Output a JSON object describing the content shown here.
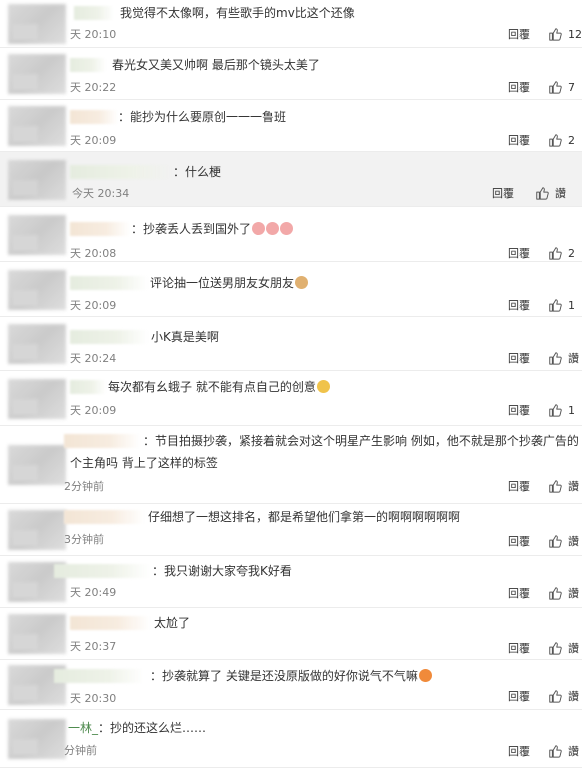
{
  "comments": [
    {
      "text": "我觉得不太像啊，有些歌手的mv比这个还像",
      "time": "天 20:10",
      "reply": "回覆",
      "likes": "12",
      "emoji": ""
    },
    {
      "text": "春光女又美又帅啊 最后那个镜头太美了",
      "time": "天 20:22",
      "reply": "回覆",
      "likes": "7",
      "emoji": ""
    },
    {
      "text": "：能抄为什么要原创一一一鲁班",
      "time": "天 20:09",
      "reply": "回覆",
      "likes": "2",
      "emoji": ""
    },
    {
      "text": "：什么梗",
      "time": "今天 20:34",
      "reply": "回覆",
      "likes": "讚",
      "emoji": ""
    },
    {
      "text": "：抄袭丢人丢到国外了",
      "time": "天 20:08",
      "reply": "回覆",
      "likes": "2",
      "emoji": "pig-emoji"
    },
    {
      "text": "评论抽一位送男朋友女朋友",
      "time": "天 20:09",
      "reply": "回覆",
      "likes": "1",
      "emoji": "dog-emoji"
    },
    {
      "text": "小K真是美啊",
      "time": "天 20:24",
      "reply": "回覆",
      "likes": "讚",
      "emoji": ""
    },
    {
      "text": "每次都有幺蛾子 就不能有点自己的创意",
      "time": "天 20:09",
      "reply": "回覆",
      "likes": "1",
      "emoji": "sad-emoji"
    },
    {
      "text": "：节目拍摄抄袭，紧接着就会对这个明星产生影响  例如，他不就是那个抄袭广告的",
      "text2": "个主角吗  背上了这样的标签",
      "time": "2分钟前",
      "reply": "回覆",
      "likes": "讚",
      "emoji": ""
    },
    {
      "text": "仔细想了一想这排名，都是希望他们拿第一的啊啊啊啊啊啊",
      "time": "3分钟前",
      "reply": "回覆",
      "likes": "讚",
      "emoji": ""
    },
    {
      "text": "：我只谢谢大家夸我K好看",
      "time": "天 20:49",
      "reply": "回覆",
      "likes": "讚",
      "emoji": ""
    },
    {
      "text": "太尬了",
      "time": "天 20:37",
      "reply": "回覆",
      "likes": "讚",
      "emoji": ""
    },
    {
      "text": "：抄袭就算了  关键是还没原版做的好你说气不气嘛",
      "time": "天 20:30",
      "reply": "回覆",
      "likes": "讚",
      "emoji": "fire-emoji"
    },
    {
      "name": "一林_",
      "text": "：抄的还这么烂……",
      "time": "分钟前",
      "reply": "回覆",
      "likes": "讚",
      "emoji": ""
    }
  ],
  "colors": {
    "background": "#ffffff",
    "highlight_row": "#f2f2f2",
    "divider": "#ececec",
    "time_text": "#808080"
  },
  "icons": {
    "like": "thumbs-up-icon"
  }
}
